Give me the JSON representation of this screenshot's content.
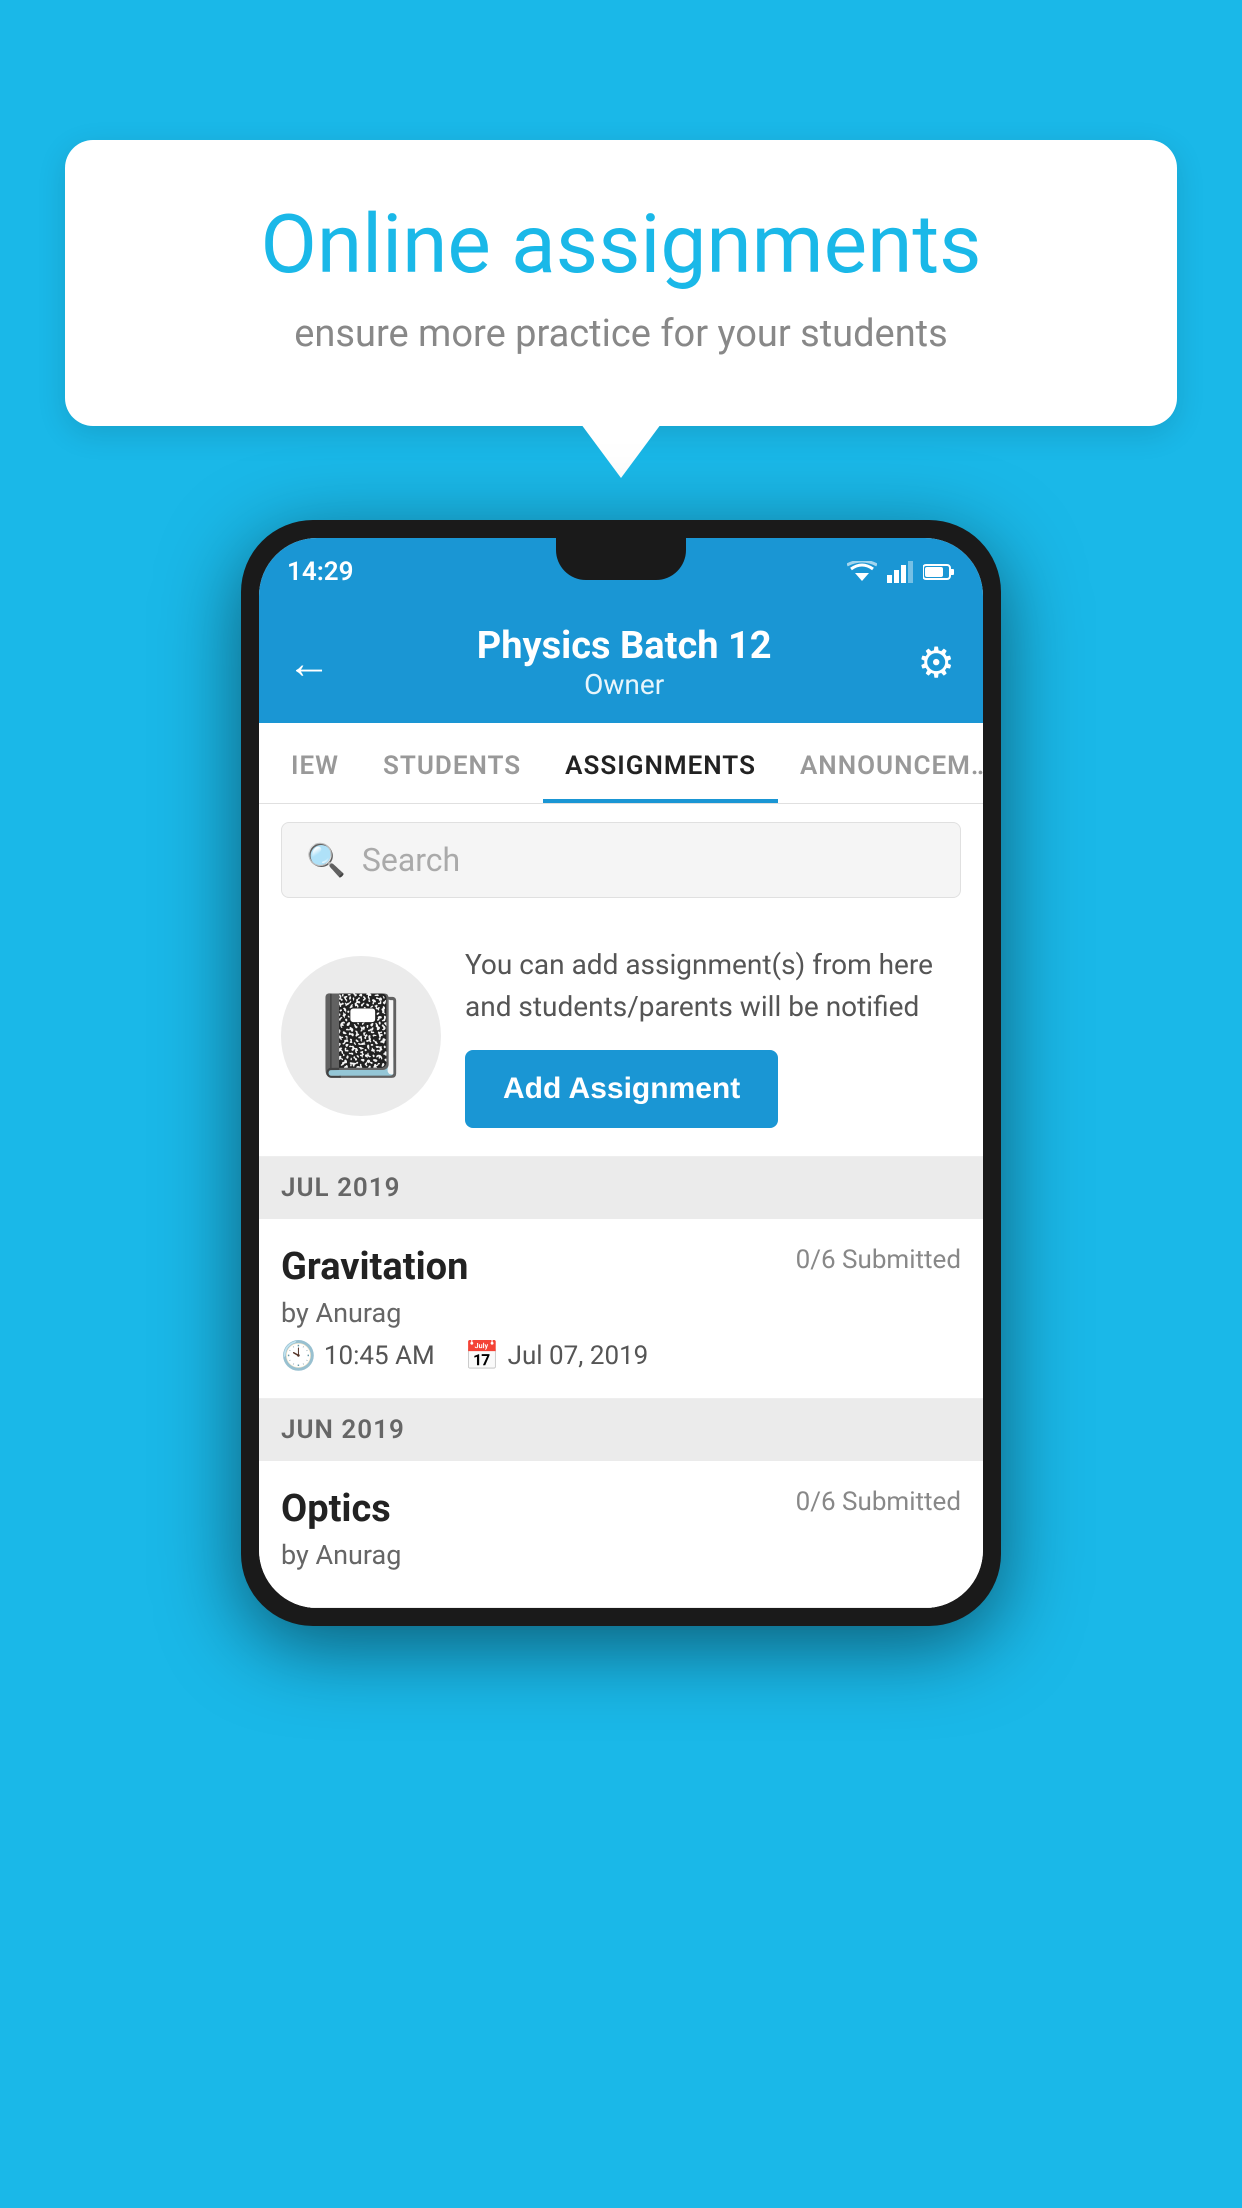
{
  "background": {
    "color": "#1ab8e8"
  },
  "speech_bubble": {
    "title": "Online assignments",
    "subtitle": "ensure more practice for your students"
  },
  "phone": {
    "status_bar": {
      "time": "14:29"
    },
    "header": {
      "title": "Physics Batch 12",
      "subtitle": "Owner"
    },
    "tabs": [
      {
        "label": "IEW",
        "active": false
      },
      {
        "label": "STUDENTS",
        "active": false
      },
      {
        "label": "ASSIGNMENTS",
        "active": true
      },
      {
        "label": "ANNOUNCEM…",
        "active": false
      }
    ],
    "search": {
      "placeholder": "Search"
    },
    "promo": {
      "description": "You can add assignment(s) from here and students/parents will be notified",
      "button_label": "Add Assignment"
    },
    "sections": [
      {
        "month": "JUL 2019",
        "assignments": [
          {
            "name": "Gravitation",
            "submitted": "0/6 Submitted",
            "by": "by Anurag",
            "time": "10:45 AM",
            "date": "Jul 07, 2019"
          }
        ]
      },
      {
        "month": "JUN 2019",
        "assignments": [
          {
            "name": "Optics",
            "submitted": "0/6 Submitted",
            "by": "by Anurag",
            "time": "",
            "date": ""
          }
        ]
      }
    ]
  }
}
